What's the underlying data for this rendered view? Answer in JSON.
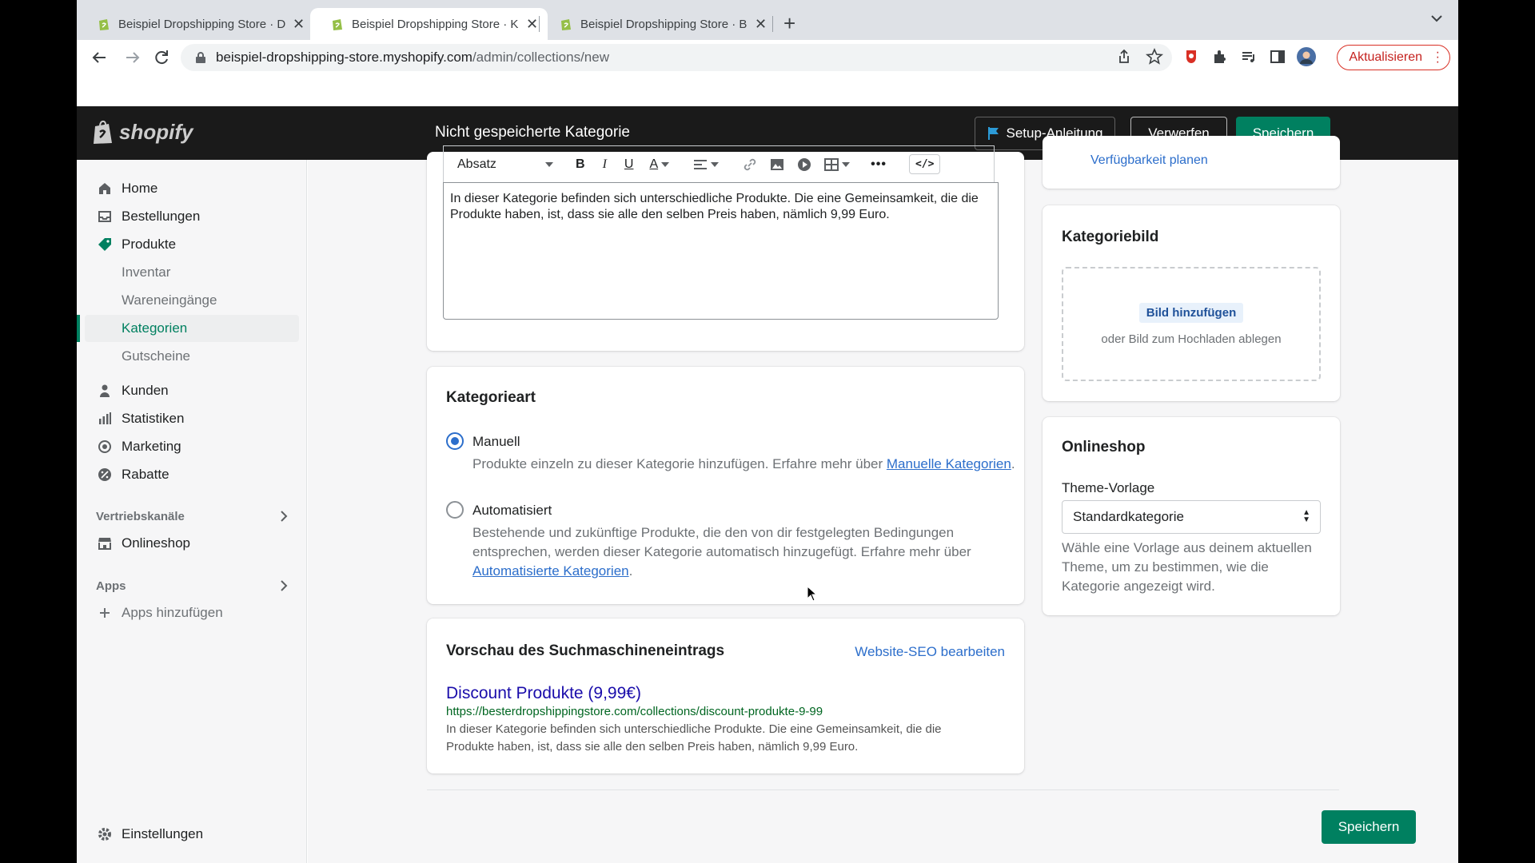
{
  "browser": {
    "tabs": [
      {
        "title": "Beispiel Dropshipping Store · D",
        "active": false
      },
      {
        "title": "Beispiel Dropshipping Store · K",
        "active": true
      },
      {
        "title": "Beispiel Dropshipping Store · B",
        "active": false
      }
    ],
    "url_host": "beispiel-dropshipping-store.myshopify.com",
    "url_path": "/admin/collections/new",
    "update_button": "Aktualisieren"
  },
  "topbar": {
    "logo_text": "shopify",
    "page_title": "Nicht gespeicherte Kategorie",
    "setup_label": "Setup-Anleitung",
    "discard_label": "Verwerfen",
    "save_label": "Speichern"
  },
  "sidebar": {
    "items": [
      {
        "label": "Home",
        "icon": "home-icon"
      },
      {
        "label": "Bestellungen",
        "icon": "inbox-icon"
      },
      {
        "label": "Produkte",
        "icon": "tag-icon"
      },
      {
        "label": "Inventar"
      },
      {
        "label": "Wareneingänge"
      },
      {
        "label": "Kategorien"
      },
      {
        "label": "Gutscheine"
      },
      {
        "label": "Kunden",
        "icon": "person-icon"
      },
      {
        "label": "Statistiken",
        "icon": "bar-chart-icon"
      },
      {
        "label": "Marketing",
        "icon": "target-icon"
      },
      {
        "label": "Rabatte",
        "icon": "discount-icon"
      }
    ],
    "sales_channels_label": "Vertriebskanäle",
    "onlineshop_label": "Onlineshop",
    "apps_label": "Apps",
    "add_apps_label": "Apps hinzufügen",
    "settings_label": "Einstellungen"
  },
  "editor": {
    "format_label": "Absatz",
    "content": "In dieser Kategorie befinden sich unterschiedliche Produkte. Die eine Gemeinsamkeit, die die Produkte haben, ist, dass sie alle den selben Preis haben, nämlich 9,99 Euro."
  },
  "availability_link": "Verfügbarkeit planen",
  "collection_type": {
    "title": "Kategorieart",
    "manual_label": "Manuell",
    "manual_help": "Produkte einzeln zu dieser Kategorie hinzufügen. Erfahre mehr über ",
    "manual_link": "Manuelle Kategorien",
    "auto_label": "Automatisiert",
    "auto_help": "Bestehende und zukünftige Produkte, die den von dir festgelegten Bedingungen entsprechen, werden dieser Kategorie automatisch hinzugefügt. Erfahre mehr über ",
    "auto_link": "Automatisierte Kategorien",
    "selected": "manual"
  },
  "seo": {
    "title": "Vorschau des Suchmaschineneintrags",
    "edit_link": "Website-SEO bearbeiten",
    "preview_title": "Discount Produkte (9,99€)",
    "preview_url": "https://besterdropshippingstore.com/collections/discount-produkte-9-99",
    "preview_desc": "In dieser Kategorie befinden sich unterschiedliche Produkte. Die eine Gemeinsamkeit, die die Produkte haben, ist, dass sie alle den selben Preis haben, nämlich 9,99 Euro."
  },
  "image": {
    "title": "Kategoriebild",
    "add_label": "Bild hinzufügen",
    "drop_hint": "oder Bild zum Hochladen ablegen"
  },
  "onlineshop": {
    "title": "Onlineshop",
    "template_label": "Theme-Vorlage",
    "template_value": "Standardkategorie",
    "template_help": "Wähle eine Vorlage aus deinem aktuellen Theme, um zu bestimmen, wie die Kategorie angezeigt wird."
  },
  "footer": {
    "save_label": "Speichern"
  },
  "colors": {
    "accent": "#008060",
    "link": "#2c6ecb",
    "topbar": "#1a1a1a"
  }
}
